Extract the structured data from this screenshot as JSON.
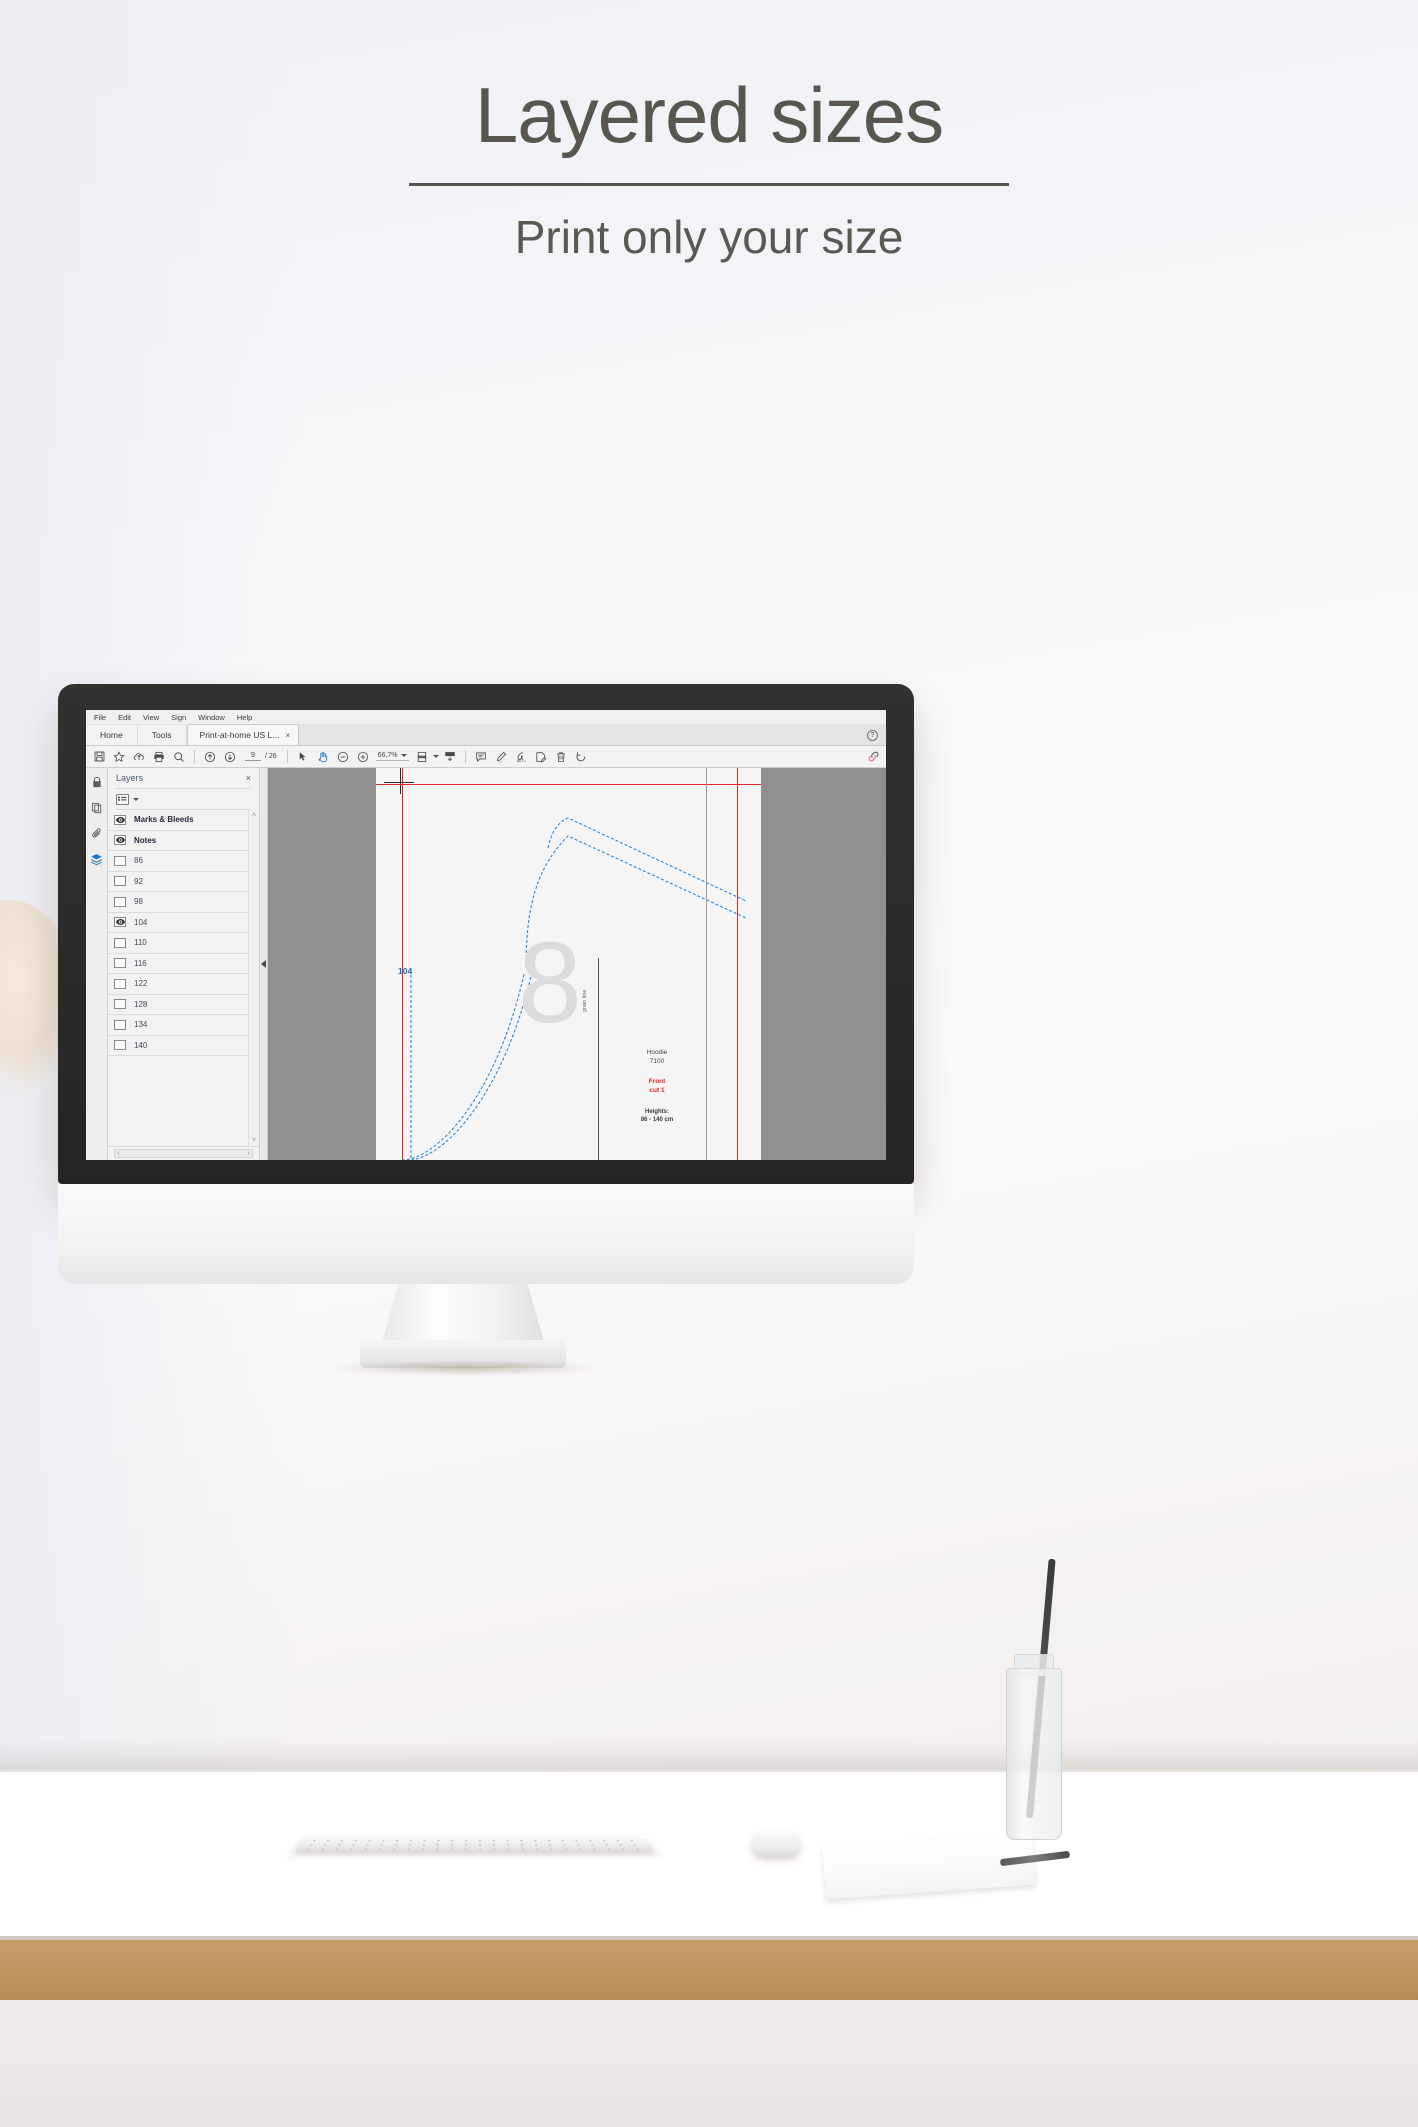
{
  "poster": {
    "headline": "Layered sizes",
    "subhead": "Print only your size"
  },
  "app": {
    "menubar": [
      "File",
      "Edit",
      "View",
      "Sign",
      "Window",
      "Help"
    ],
    "tabs": {
      "home": "Home",
      "tools": "Tools",
      "document": "Print-at-home US L...",
      "close_glyph": "×"
    },
    "help_glyph": "?",
    "toolbar": {
      "icons_left": [
        "save-icon",
        "star-icon",
        "upload-cloud-icon",
        "print-icon",
        "search-icon"
      ],
      "page_prev": "previous-page-icon",
      "page_next": "next-page-icon",
      "page_current": "9",
      "page_total": "/ 26",
      "select_tool": "select-arrow-icon",
      "hand_tool": "hand-icon",
      "zoom_out": "zoom-out-icon",
      "zoom_in": "zoom-in-icon",
      "zoom_level": "66,7%",
      "fit_page": "fit-page-icon",
      "scroll_mode": "scroll-mode-icon",
      "comment": "comment-icon",
      "highlight": "highlight-icon",
      "sign": "sign-icon",
      "stamp": "stamp-icon",
      "delete": "trash-icon",
      "rotate": "rotate-icon",
      "share": "link-icon"
    },
    "rail": [
      "lock-icon",
      "pages-icon",
      "attachment-icon",
      "layers-icon"
    ],
    "layers_panel": {
      "title": "Layers",
      "close_glyph": "×",
      "options_icon": "list-options-icon",
      "scroll_up_glyph": "˄",
      "scroll_down_glyph": "˅",
      "hscroll_left_glyph": "‹",
      "hscroll_right_glyph": "›",
      "items": [
        {
          "label": "Marks & Bleeds",
          "visible": true,
          "bold": true
        },
        {
          "label": "Notes",
          "visible": true,
          "bold": true
        },
        {
          "label": "86",
          "visible": false,
          "bold": false
        },
        {
          "label": "92",
          "visible": false,
          "bold": false
        },
        {
          "label": "98",
          "visible": false,
          "bold": false
        },
        {
          "label": "104",
          "visible": true,
          "bold": false
        },
        {
          "label": "110",
          "visible": false,
          "bold": false
        },
        {
          "label": "116",
          "visible": false,
          "bold": false
        },
        {
          "label": "122",
          "visible": false,
          "bold": false
        },
        {
          "label": "128",
          "visible": false,
          "bold": false
        },
        {
          "label": "134",
          "visible": false,
          "bold": false
        },
        {
          "label": "140",
          "visible": false,
          "bold": false
        }
      ]
    },
    "document": {
      "size_label": "104",
      "watermark": "8",
      "grain_line": "grain line",
      "piece_name": "Hoodie",
      "piece_code": "7100",
      "piece_part": "Front",
      "piece_cut": "cut 1",
      "heights_label": "Heights:",
      "heights_value": "86 - 140 cm"
    }
  },
  "colors": {
    "accent_blue": "#2176c7",
    "pattern_blue": "#2f86d0",
    "bleed_red": "#e8202a",
    "cut_red": "#e02020",
    "headline_gray": "#58564f"
  }
}
